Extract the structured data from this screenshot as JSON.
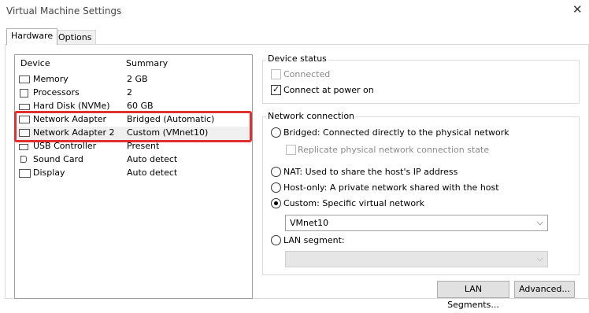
{
  "window": {
    "title": "Virtual Machine Settings",
    "close_glyph": "✕"
  },
  "tabs": [
    {
      "label": "Hardware",
      "active": true
    },
    {
      "label": "Options",
      "active": false
    }
  ],
  "device_list": {
    "headers": {
      "device": "Device",
      "summary": "Summary"
    },
    "rows": [
      {
        "icon": "memory-icon",
        "name": "Memory",
        "summary": "2 GB"
      },
      {
        "icon": "processor-icon",
        "name": "Processors",
        "summary": "2"
      },
      {
        "icon": "hard-disk-icon",
        "name": "Hard Disk (NVMe)",
        "summary": "60 GB"
      },
      {
        "icon": "network-adapter-icon",
        "name": "Network Adapter",
        "summary": "Bridged (Automatic)"
      },
      {
        "icon": "network-adapter-icon",
        "name": "Network Adapter 2",
        "summary": "Custom (VMnet10)",
        "selected": true
      },
      {
        "icon": "usb-icon",
        "name": "USB Controller",
        "summary": "Present"
      },
      {
        "icon": "speaker-icon",
        "name": "Sound Card",
        "summary": "Auto detect"
      },
      {
        "icon": "monitor-icon",
        "name": "Display",
        "summary": "Auto detect"
      }
    ],
    "highlight_color": "#e03030"
  },
  "device_status": {
    "label": "Device status",
    "connected": {
      "label": "Connected",
      "checked": false,
      "enabled": false
    },
    "connect_at_power_on": {
      "label": "Connect at power on",
      "checked": true,
      "enabled": true
    }
  },
  "network_connection": {
    "label": "Network connection",
    "bridged": {
      "label": "Bridged: Connected directly to the physical network",
      "selected": false
    },
    "replicate": {
      "label": "Replicate physical network connection state",
      "checked": false,
      "enabled": false
    },
    "nat": {
      "label": "NAT: Used to share the host's IP address",
      "selected": false
    },
    "host_only": {
      "label": "Host-only: A private network shared with the host",
      "selected": false
    },
    "custom": {
      "label": "Custom: Specific virtual network",
      "selected": true
    },
    "custom_select_value": "VMnet10",
    "lan_segment": {
      "label": "LAN segment:",
      "selected": false
    },
    "lan_segment_select_value": ""
  },
  "buttons": {
    "lan_segments": "LAN Segments...",
    "advanced": "Advanced..."
  }
}
